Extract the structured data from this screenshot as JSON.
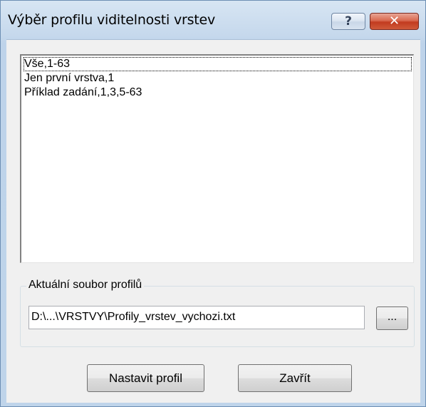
{
  "window": {
    "title": "Výběr profilu viditelnosti vrstev",
    "help_label": "?",
    "close_label": "✕"
  },
  "profiles": {
    "items": [
      {
        "label": "Vše,1-63",
        "focused": true
      },
      {
        "label": "Jen první vrstva,1",
        "focused": false
      },
      {
        "label": "Příklad zadání,1,3,5-63",
        "focused": false
      }
    ]
  },
  "profile_file": {
    "group_label": "Aktuální soubor profilů",
    "path_value": "D:\\...\\VRSTVY\\Profily_vrstev_vychozi.txt",
    "browse_label": "..."
  },
  "buttons": {
    "set_profile": "Nastavit profil",
    "close": "Zavřít"
  }
}
